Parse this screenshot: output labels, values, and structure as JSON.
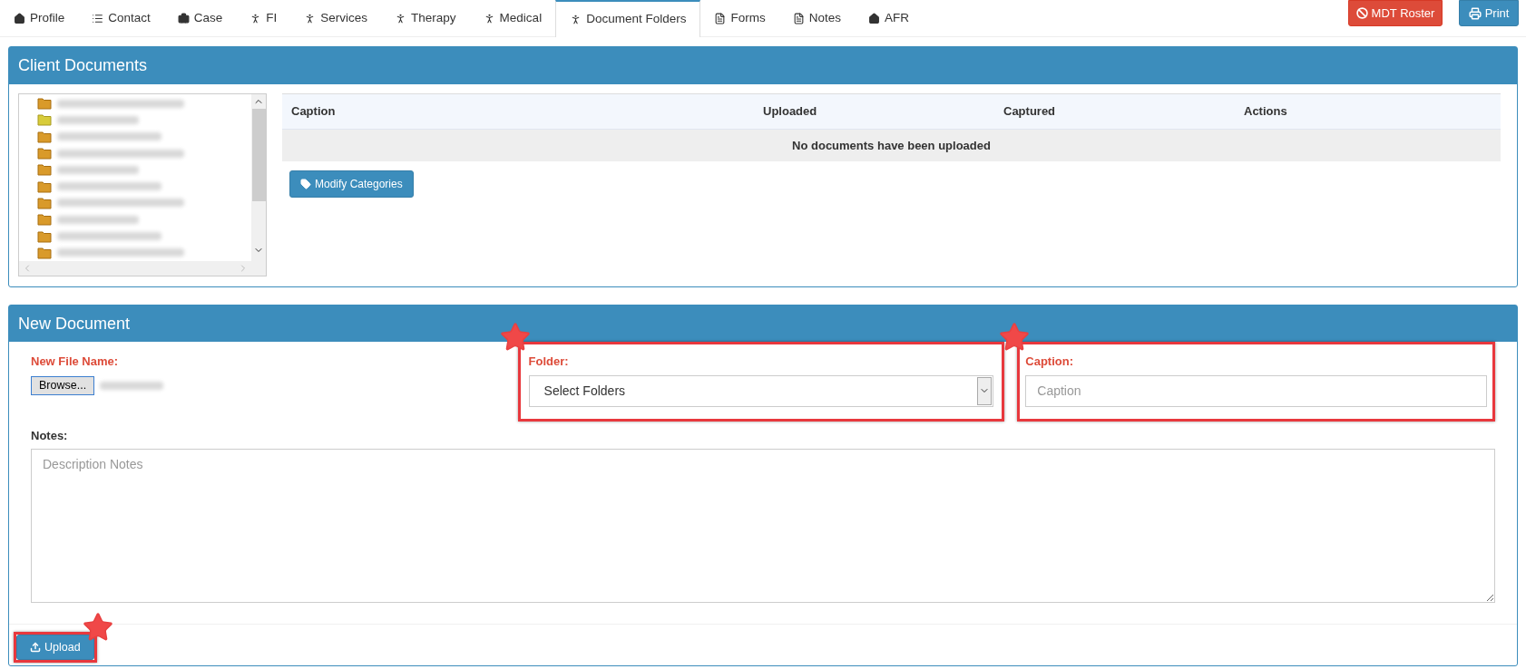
{
  "tabs": [
    {
      "label": "Profile",
      "selected": false
    },
    {
      "label": "Contact",
      "selected": false
    },
    {
      "label": "Case",
      "selected": false
    },
    {
      "label": "FI",
      "selected": false
    },
    {
      "label": "Services",
      "selected": false
    },
    {
      "label": "Therapy",
      "selected": false
    },
    {
      "label": "Medical",
      "selected": false
    },
    {
      "label": "Document Folders",
      "selected": true
    },
    {
      "label": "Forms",
      "selected": false
    },
    {
      "label": "Notes",
      "selected": false
    },
    {
      "label": "AFR",
      "selected": false
    }
  ],
  "header_buttons": [
    {
      "label": "MDT Roster",
      "kind": "danger"
    },
    {
      "label": "Print",
      "kind": "primary"
    }
  ],
  "client_documents": {
    "title": "Client Documents",
    "folders": [
      {
        "selected": false
      },
      {
        "selected": true
      },
      {
        "selected": false
      },
      {
        "selected": false
      },
      {
        "selected": false
      },
      {
        "selected": false
      },
      {
        "selected": false
      },
      {
        "selected": false
      },
      {
        "selected": false
      },
      {
        "selected": false
      }
    ],
    "table": {
      "columns": [
        "Caption",
        "Uploaded",
        "Captured",
        "Actions"
      ],
      "empty_message": "No documents have been uploaded"
    },
    "modify_button": "Modify Categories"
  },
  "new_document": {
    "title": "New Document",
    "file": {
      "label": "New File Name:",
      "browse": "Browse..."
    },
    "folder": {
      "label": "Folder:",
      "value": "Select Folders",
      "highlighted": true
    },
    "caption": {
      "label": "Caption:",
      "placeholder": "Caption",
      "highlighted": true
    },
    "notes": {
      "label": "Notes:",
      "placeholder": "Description Notes"
    },
    "upload": {
      "label": "Upload",
      "highlighted": true
    }
  }
}
